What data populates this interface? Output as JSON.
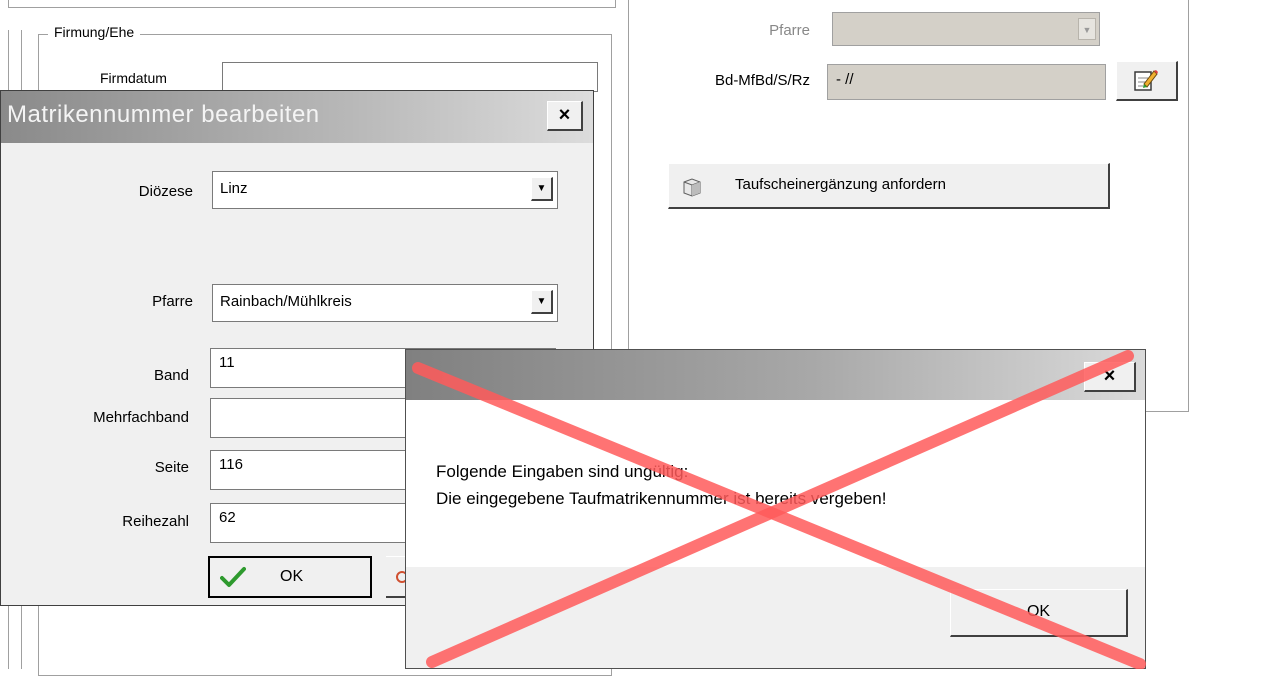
{
  "main_form": {
    "group_title": "Firmung/Ehe",
    "firm_date_label": "Firmdatum",
    "pfarre_label": "Pfarre",
    "pfarre_value": "",
    "bd_label": "Bd-MfBd/S/Rz",
    "bd_value": "- //",
    "request_button_label": "Taufscheinergänzung anfordern"
  },
  "edit_dialog": {
    "title": "Matrikennummer bearbeiten",
    "close_glyph": "×",
    "dioezese_label": "Diözese",
    "dioezese_value": "Linz",
    "pfarre_label": "Pfarre",
    "pfarre_value": "Rainbach/Mühlkreis",
    "band_label": "Band",
    "band_value": "11",
    "mehrfachband_label": "Mehrfachband",
    "mehrfachband_value": "",
    "seite_label": "Seite",
    "seite_value": "116",
    "reihezahl_label": "Reihezahl",
    "reihezahl_value": "62",
    "ok_label": "OK"
  },
  "error_dialog": {
    "title": "",
    "close_glyph": "×",
    "message_line1": "Folgende Eingaben sind ungültig:",
    "message_line2": "Die eingegebene Taufmatrikennummer ist bereits vergeben!",
    "ok_label": "OK"
  },
  "annotation": {
    "cross_color": "#ff5a5a"
  },
  "icons": [
    "dropdown-arrow-icon",
    "edit-pencil-icon",
    "document-box-icon",
    "checkmark-icon",
    "close-icon"
  ]
}
